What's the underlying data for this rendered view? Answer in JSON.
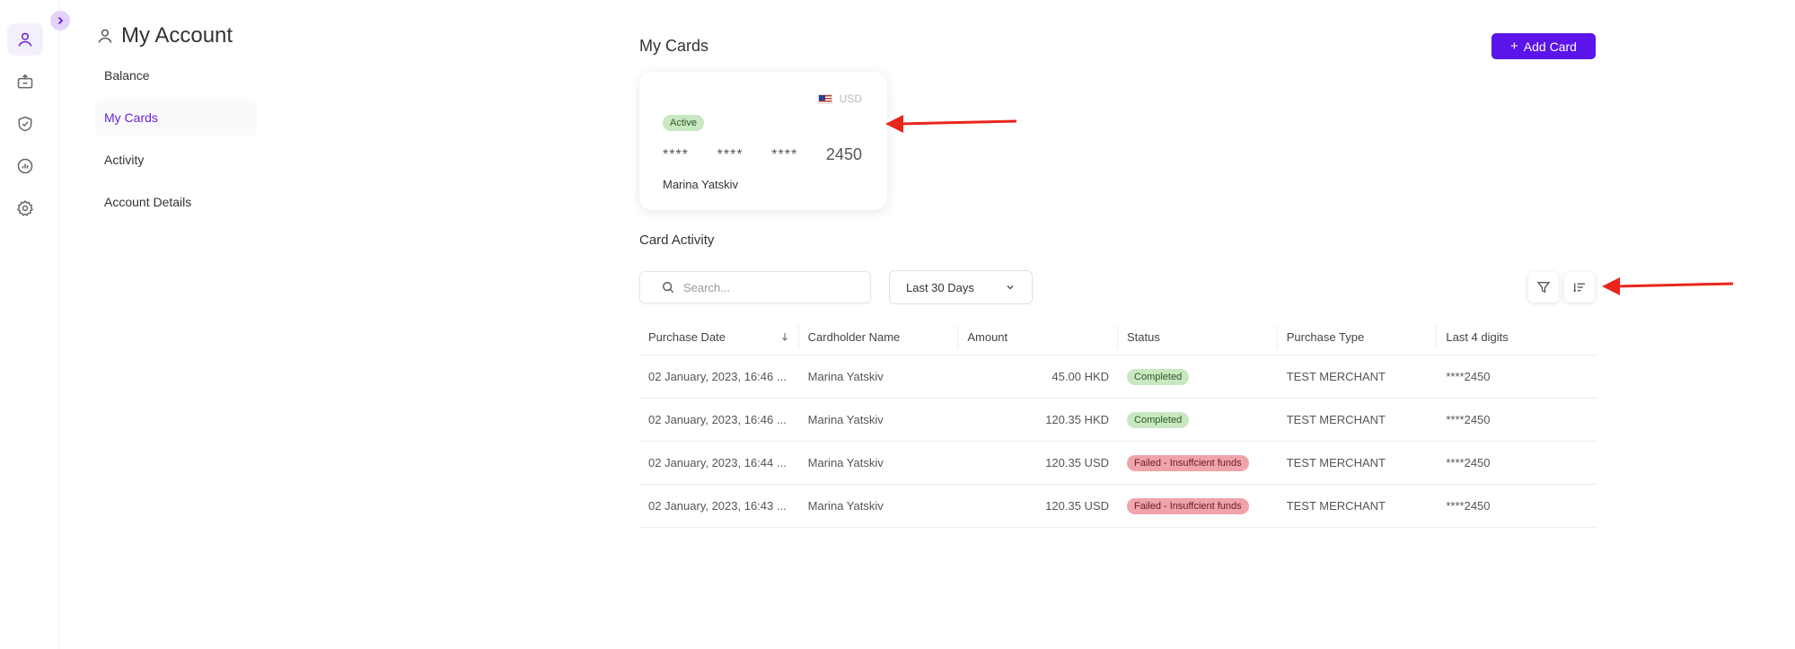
{
  "rail": {
    "items": [
      {
        "icon": "user-icon",
        "active": true
      },
      {
        "icon": "bank-card-icon",
        "active": false
      },
      {
        "icon": "shield-check-icon",
        "active": false
      },
      {
        "icon": "chart-icon",
        "active": false
      },
      {
        "icon": "gear-icon",
        "active": false
      }
    ]
  },
  "account": {
    "title": "My Account",
    "nav": [
      {
        "label": "Balance",
        "active": false
      },
      {
        "label": "My Cards",
        "active": true
      },
      {
        "label": "Activity",
        "active": false
      },
      {
        "label": "Account Details",
        "active": false
      }
    ]
  },
  "cards": {
    "title": "My Cards",
    "add_label": "Add Card",
    "card": {
      "currency": "USD",
      "status": "Active",
      "mask": [
        "****",
        "****",
        "****"
      ],
      "last4": "2450",
      "holder": "Marina Yatskiv"
    }
  },
  "activity": {
    "title": "Card Activity",
    "search_placeholder": "Search...",
    "range": "Last 30 Days",
    "columns": [
      "Purchase Date",
      "Cardholder Name",
      "Amount",
      "Status",
      "Purchase Type",
      "Last 4 digits"
    ],
    "rows": [
      {
        "date": "02 January, 2023, 16:46 ...",
        "name": "Marina Yatskiv",
        "amount": "45.00 HKD",
        "status": "Completed",
        "status_kind": "green",
        "type": "TEST MERCHANT",
        "last4": "****2450"
      },
      {
        "date": "02 January, 2023, 16:46 ...",
        "name": "Marina Yatskiv",
        "amount": "120.35 HKD",
        "status": "Completed",
        "status_kind": "green",
        "type": "TEST MERCHANT",
        "last4": "****2450"
      },
      {
        "date": "02 January, 2023, 16:44 ...",
        "name": "Marina Yatskiv",
        "amount": "120.35 USD",
        "status": "Failed - Insuffcient funds",
        "status_kind": "red",
        "type": "TEST MERCHANT",
        "last4": "****2450"
      },
      {
        "date": "02 January, 2023, 16:43 ...",
        "name": "Marina Yatskiv",
        "amount": "120.35 USD",
        "status": "Failed - Insuffcient funds",
        "status_kind": "red",
        "type": "TEST MERCHANT",
        "last4": "****2450"
      }
    ]
  },
  "colors": {
    "accent": "#5b14ea",
    "active_nav": "#6a1fe0",
    "success_bg": "#c7e8c0",
    "error_bg": "#f0a3ab",
    "annotation_arrow": "#e8261c"
  }
}
